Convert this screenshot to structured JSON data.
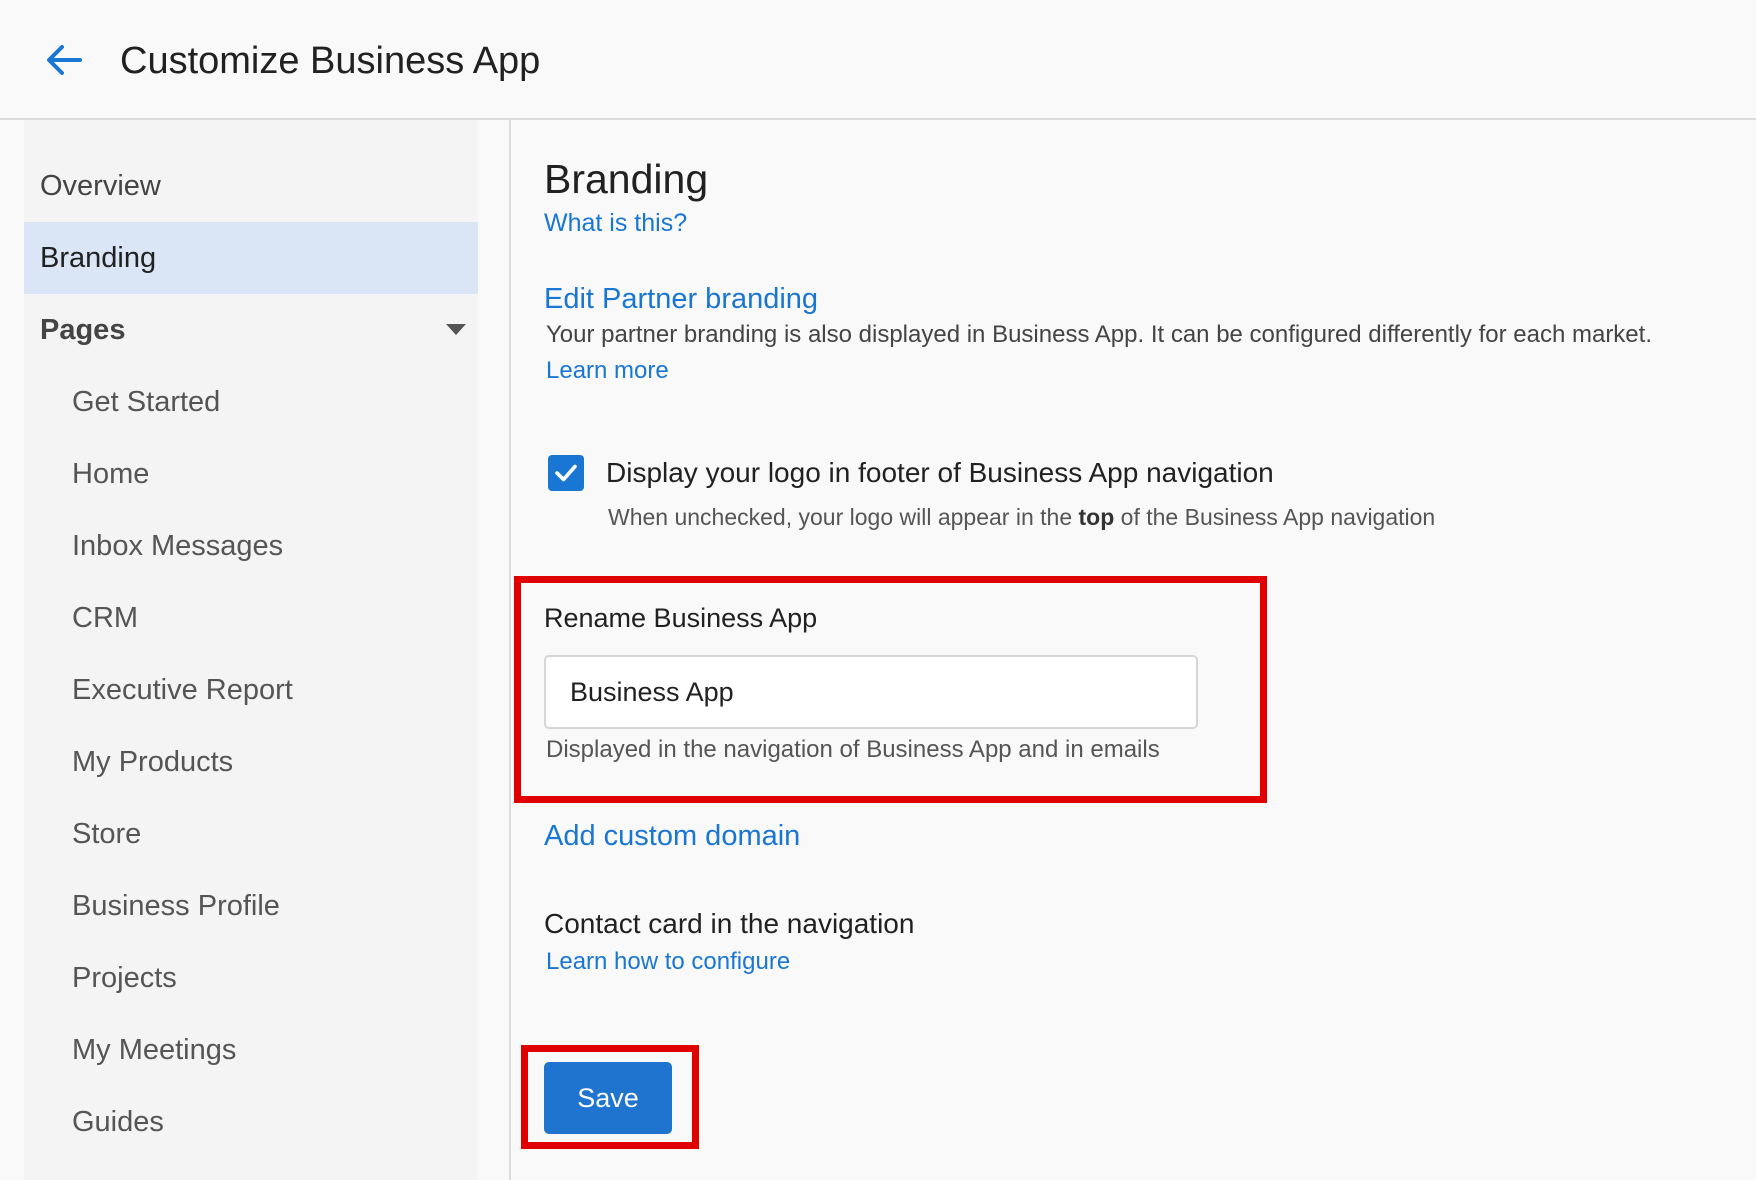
{
  "header": {
    "title": "Customize Business App",
    "back_icon": "arrow-left-icon"
  },
  "sidebar": {
    "items": [
      {
        "label": "Overview"
      },
      {
        "label": "Branding",
        "active": true
      },
      {
        "label": "Pages",
        "expanded": true
      }
    ],
    "sub_items": [
      {
        "label": "Get Started"
      },
      {
        "label": "Home"
      },
      {
        "label": "Inbox Messages"
      },
      {
        "label": "CRM"
      },
      {
        "label": "Executive Report"
      },
      {
        "label": "My Products"
      },
      {
        "label": "Store"
      },
      {
        "label": "Business Profile"
      },
      {
        "label": "Projects"
      },
      {
        "label": "My Meetings"
      },
      {
        "label": "Guides"
      }
    ]
  },
  "main": {
    "title": "Branding",
    "what_is_this": "What is this?",
    "edit_partner_link": "Edit Partner branding",
    "partner_desc": "Your partner branding is also displayed in Business App. It can be configured differently for each market.",
    "learn_more": "Learn more",
    "logo_checkbox": {
      "checked": true,
      "label": "Display your logo in footer of Business App navigation",
      "hint_before": "When unchecked, your logo will appear in the ",
      "hint_bold": "top",
      "hint_after": " of the Business App navigation"
    },
    "rename": {
      "label": "Rename Business App",
      "value": "Business App",
      "hint": "Displayed in the navigation of Business App and in emails"
    },
    "custom_domain_link": "Add custom domain",
    "contact_title": "Contact card in the navigation",
    "contact_link": "Learn how to configure",
    "save_label": "Save"
  },
  "colors": {
    "accent": "#1976d2",
    "highlight": "#e00000",
    "active_nav": "#dae6f6"
  }
}
